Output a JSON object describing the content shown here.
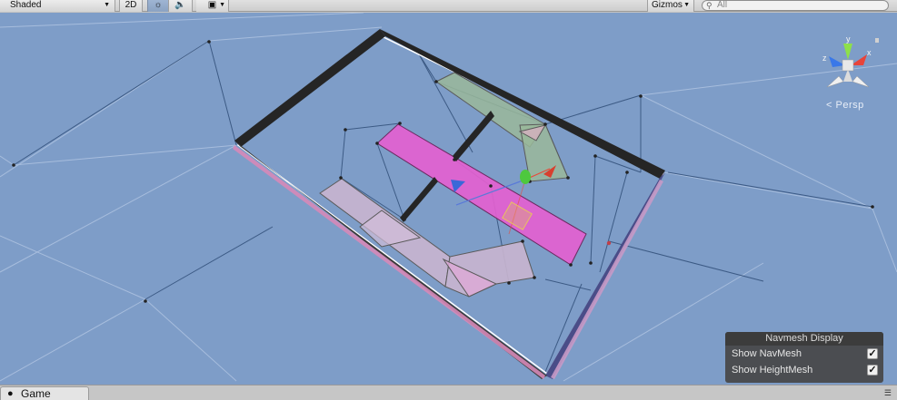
{
  "toolbar": {
    "shading_mode": "Shaded",
    "mode_2d": "2D",
    "lighting_icon": "sun-icon",
    "audio_icon": "speaker-icon",
    "effects_icon": "image-icon",
    "gizmos_label": "Gizmos",
    "search_placeholder": "All"
  },
  "gizmo": {
    "axis_y": "y",
    "axis_x": "x",
    "axis_z": "z",
    "projection_label": "Persp",
    "colors": {
      "x": "#e8443a",
      "y": "#8ee04a",
      "z": "#3a78e8"
    }
  },
  "navmesh_panel": {
    "title": "Navmesh Display",
    "rows": [
      {
        "label": "Show NavMesh",
        "checked": true
      },
      {
        "label": "Show HeightMesh",
        "checked": true
      }
    ]
  },
  "bottom_tabs": {
    "game_label": "Game"
  },
  "colors": {
    "viewport_bg": "#7e9dc8",
    "navmesh_magenta": "#e55fd0",
    "navmesh_green": "#9ab89a",
    "navmesh_lilac": "#c9b5cf",
    "wall": "#222222"
  }
}
